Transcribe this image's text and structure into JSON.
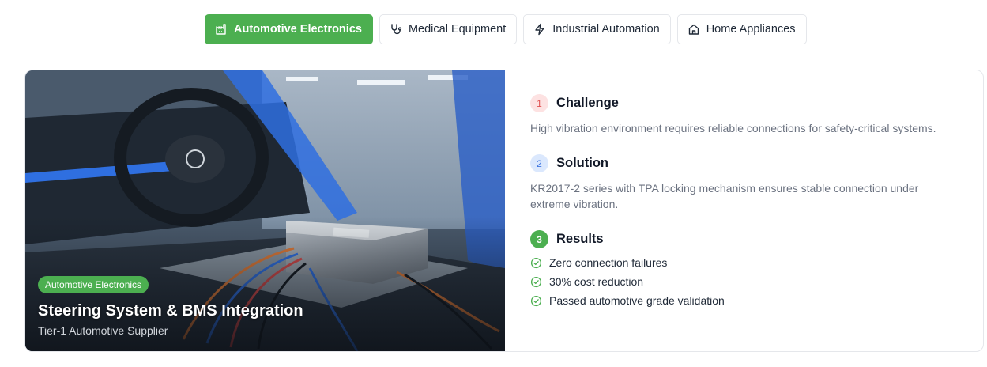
{
  "tabs": [
    {
      "label": "Automotive Electronics",
      "icon": "factory-icon",
      "active": true
    },
    {
      "label": "Medical Equipment",
      "icon": "stethoscope-icon",
      "active": false
    },
    {
      "label": "Industrial Automation",
      "icon": "lightning-icon",
      "active": false
    },
    {
      "label": "Home Appliances",
      "icon": "home-icon",
      "active": false
    }
  ],
  "case": {
    "badge": "Automotive Electronics",
    "title": "Steering System & BMS Integration",
    "subtitle": "Tier-1 Automotive Supplier",
    "image": "car-interior-with-bms-module-photo"
  },
  "steps": {
    "challenge": {
      "number": "1",
      "title": "Challenge",
      "text": "High vibration environment requires reliable connections for safety-critical systems."
    },
    "solution": {
      "number": "2",
      "title": "Solution",
      "text": "KR2017-2 series with TPA locking mechanism ensures stable connection under extreme vibration."
    },
    "results": {
      "number": "3",
      "title": "Results",
      "items": [
        "Zero connection failures",
        "30% cost reduction",
        "Passed automotive grade validation"
      ]
    }
  },
  "colors": {
    "accent": "#4caf50",
    "challenge": "#e05252",
    "solution": "#3b73e0",
    "muted_text": "#6b7280"
  }
}
